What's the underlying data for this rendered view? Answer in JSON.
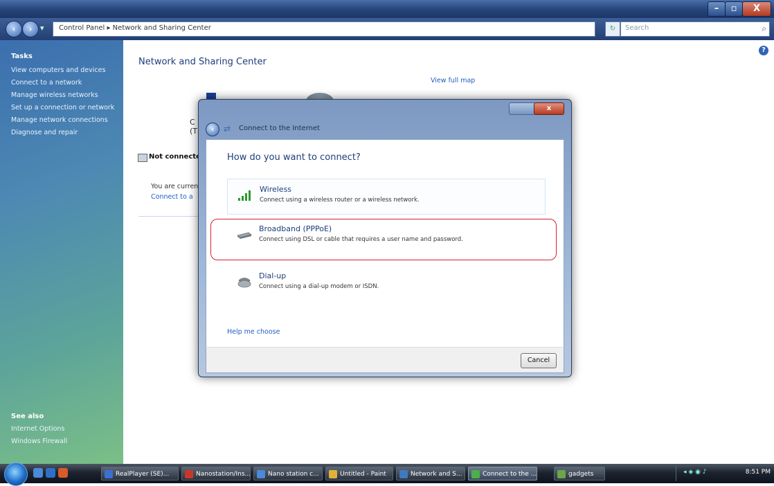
{
  "window": {
    "minimize": "–",
    "maximize": "▫",
    "close": "X"
  },
  "address": {
    "path": "Control Panel ▸ Network and Sharing Center",
    "search_placeholder": "Search"
  },
  "sidebar": {
    "tasks_heading": "Tasks",
    "items": [
      "View computers and devices",
      "Connect to a network",
      "Manage wireless networks",
      "Set up a connection or network",
      "Manage network connections",
      "Diagnose and repair"
    ],
    "see_also_heading": "See also",
    "see_also": [
      "Internet Options",
      "Windows Firewall"
    ]
  },
  "main": {
    "title": "Network and Sharing Center",
    "view_full_map": "View full map",
    "partial_c": "C",
    "partial_paren": "(T",
    "not_connected": "Not connecte",
    "you_are": "You are curren",
    "connect_link": "Connect to a"
  },
  "dialog": {
    "title": "Connect to the Internet",
    "question": "How do you want to connect?",
    "options": [
      {
        "title": "Wireless",
        "desc": "Connect using a wireless router or a wireless network."
      },
      {
        "title": "Broadband (PPPoE)",
        "desc": "Connect using DSL or cable that requires a user name and password."
      },
      {
        "title": "Dial-up",
        "desc": "Connect using a dial-up modem or ISDN."
      }
    ],
    "help_link": "Help me choose",
    "cancel": "Cancel",
    "close": "x"
  },
  "taskbar": {
    "tasks": [
      "RealPlayer (SE)...",
      "Nanostation/Ins...",
      "Nano station c...",
      "Untitled - Paint",
      "Network and S...",
      "Connect to the ...",
      "gadgets"
    ],
    "clock": "8:51 PM"
  },
  "colors": {
    "highlight": "#d2232a",
    "link": "#1f5cc2",
    "heading": "#1d3d7a"
  }
}
